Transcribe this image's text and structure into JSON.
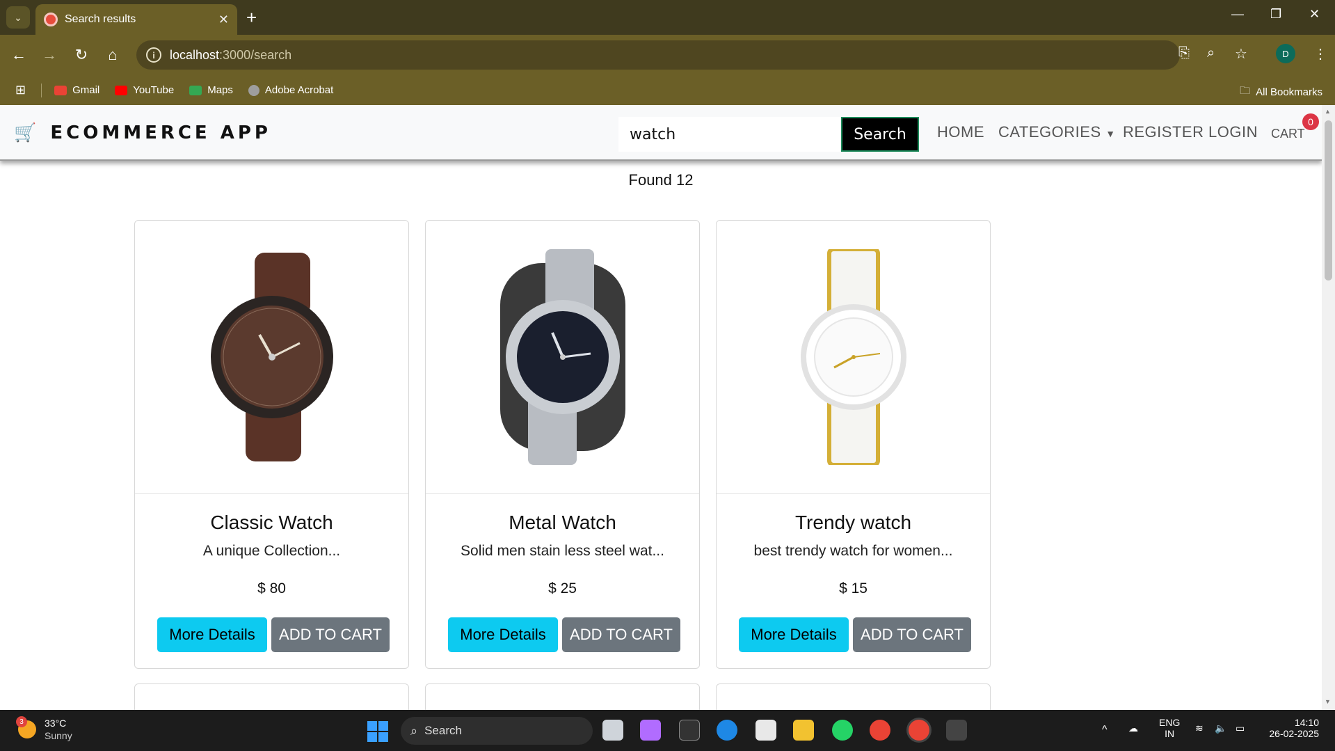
{
  "browser": {
    "tab_title": "Search results",
    "url_host": "localhost",
    "url_path": ":3000/search",
    "profile_initial": "D",
    "bookmarks": [
      {
        "label": "Gmail",
        "color": "#ea4335"
      },
      {
        "label": "YouTube",
        "color": "#ff0000"
      },
      {
        "label": "Maps",
        "color": "#34a853"
      },
      {
        "label": "Adobe Acrobat",
        "color": "#9e9e9e"
      }
    ],
    "all_bookmarks": "All Bookmarks"
  },
  "site": {
    "brand": "ECOMMERCE APP",
    "search_value": "watch",
    "search_button": "Search",
    "nav": {
      "home": "HOME",
      "categories": "CATEGORIES",
      "register": "REGISTER",
      "login": "LOGIN",
      "cart": "CART",
      "cart_count": "0"
    },
    "found_text": "Found 12",
    "products": [
      {
        "name": "Classic Watch",
        "desc": "A unique Collection...",
        "price": "$ 80",
        "details_label": "More Details",
        "cart_label": "ADD TO CART"
      },
      {
        "name": "Metal Watch",
        "desc": "Solid men stain less steel wat...",
        "price": "$ 25",
        "details_label": "More Details",
        "cart_label": "ADD TO CART"
      },
      {
        "name": "Trendy watch",
        "desc": "best trendy watch for women...",
        "price": "$ 15",
        "details_label": "More Details",
        "cart_label": "ADD TO CART"
      }
    ]
  },
  "taskbar": {
    "weather_temp": "33°C",
    "weather_desc": "Sunny",
    "weather_badge": "3",
    "search_label": "Search",
    "lang_top": "ENG",
    "lang_bottom": "IN",
    "time": "14:10",
    "date": "26-02-2025"
  },
  "colors": {
    "chrome_dark": "#3f3a1e",
    "chrome": "#6b5f27",
    "details_button": "#0dcaf0",
    "cart_button": "#6c757d",
    "cart_badge": "#dc3545"
  }
}
